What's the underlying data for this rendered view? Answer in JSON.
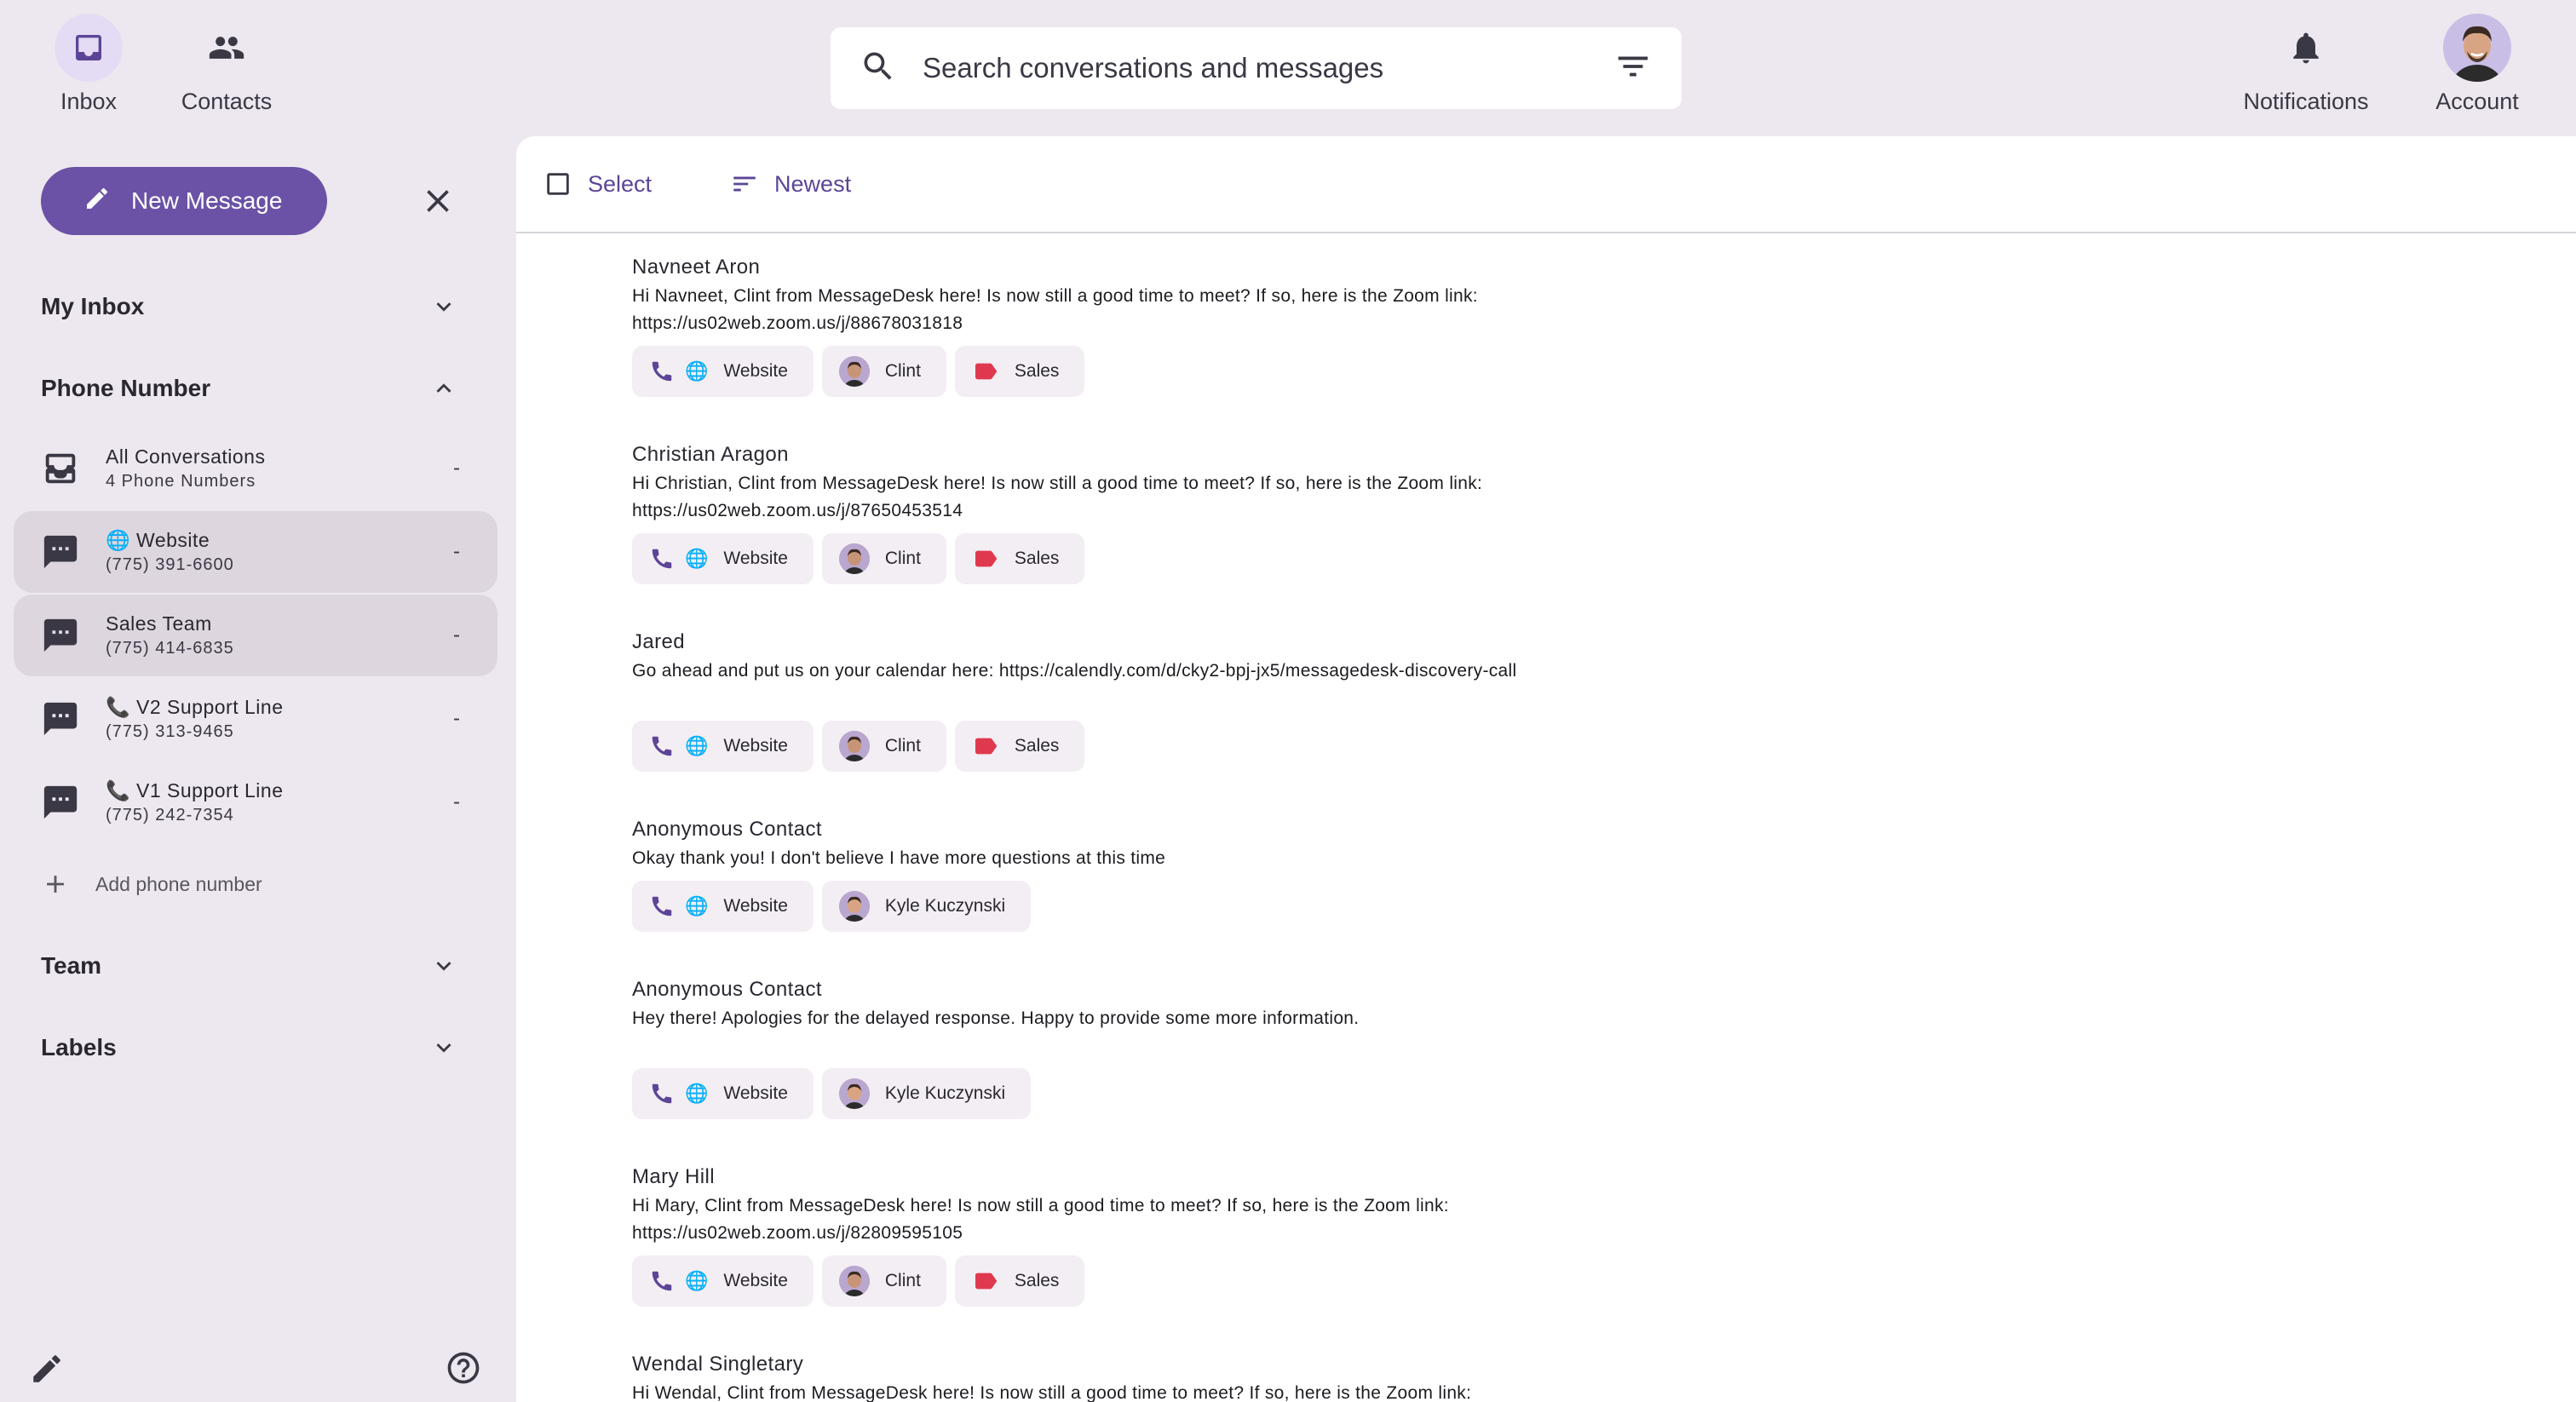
{
  "nav": {
    "inbox": "Inbox",
    "contacts": "Contacts",
    "notifications": "Notifications",
    "account": "Account"
  },
  "search": {
    "placeholder": "Search conversations and messages"
  },
  "sidebar": {
    "new_message": "New Message",
    "my_inbox": "My Inbox",
    "phone_number": "Phone Number",
    "phones": [
      {
        "title": "All Conversations",
        "subtitle": "4 Phone Numbers",
        "count": "-",
        "icon": "inbox-stack-icon"
      },
      {
        "title": "🌐 Website",
        "subtitle": "(775) 391-6600",
        "count": "-",
        "icon": "chat-bubble-icon"
      },
      {
        "title": "Sales Team",
        "subtitle": "(775) 414-6835",
        "count": "-",
        "icon": "chat-bubble-icon"
      },
      {
        "title": "📞 V2 Support Line",
        "subtitle": "(775) 313-9465",
        "count": "-",
        "icon": "chat-bubble-icon"
      },
      {
        "title": "📞 V1 Support Line",
        "subtitle": "(775) 242-7354",
        "count": "-",
        "icon": "chat-bubble-icon"
      }
    ],
    "add_phone": "Add phone number",
    "team": "Team",
    "labels": "Labels"
  },
  "toolbar": {
    "select": "Select",
    "sort": "Newest"
  },
  "conversations": [
    {
      "name": "Navneet Aron",
      "message": "Hi Navneet, Clint from MessageDesk here! Is now still a good time to meet? If so, here is the Zoom link: https://us02web.zoom.us/j/88678031818",
      "chips": {
        "line": "Website",
        "agent": "Clint",
        "label": "Sales"
      }
    },
    {
      "name": "Christian Aragon",
      "message": "Hi Christian, Clint from MessageDesk here! Is now still a good time to meet? If so, here is the Zoom link: https://us02web.zoom.us/j/87650453514",
      "chips": {
        "line": "Website",
        "agent": "Clint",
        "label": "Sales"
      }
    },
    {
      "name": "Jared",
      "message": "Go ahead and put us on your calendar here: https://calendly.com/d/cky2-bpj-jx5/messagedesk-discovery-call",
      "chips": {
        "line": "Website",
        "agent": "Clint",
        "label": "Sales"
      }
    },
    {
      "name": "Anonymous  Contact",
      "message": "Okay thank you! I don't believe I have more questions at this time",
      "chips": {
        "line": "Website",
        "agent": "Kyle Kuczynski"
      }
    },
    {
      "name": "Anonymous  Contact",
      "message": "Hey there! Apologies for the delayed response. Happy to provide some more information.",
      "chips": {
        "line": "Website",
        "agent": "Kyle Kuczynski"
      }
    },
    {
      "name": "Mary Hill",
      "message": "Hi Mary, Clint from MessageDesk here! Is now still a good time to meet? If so, here is the Zoom link: https://us02web.zoom.us/j/82809595105",
      "chips": {
        "line": "Website",
        "agent": "Clint",
        "label": "Sales"
      }
    },
    {
      "name": "Wendal Singletary",
      "message": "Hi Wendal, Clint from MessageDesk here! Is now still a good time to meet? If so, here is the Zoom link:"
    }
  ],
  "colors": {
    "accent": "#6b52a6",
    "label_red": "#e0394f",
    "sidebar_bg": "#ede8ef",
    "selected_row": "#ddd6df"
  }
}
